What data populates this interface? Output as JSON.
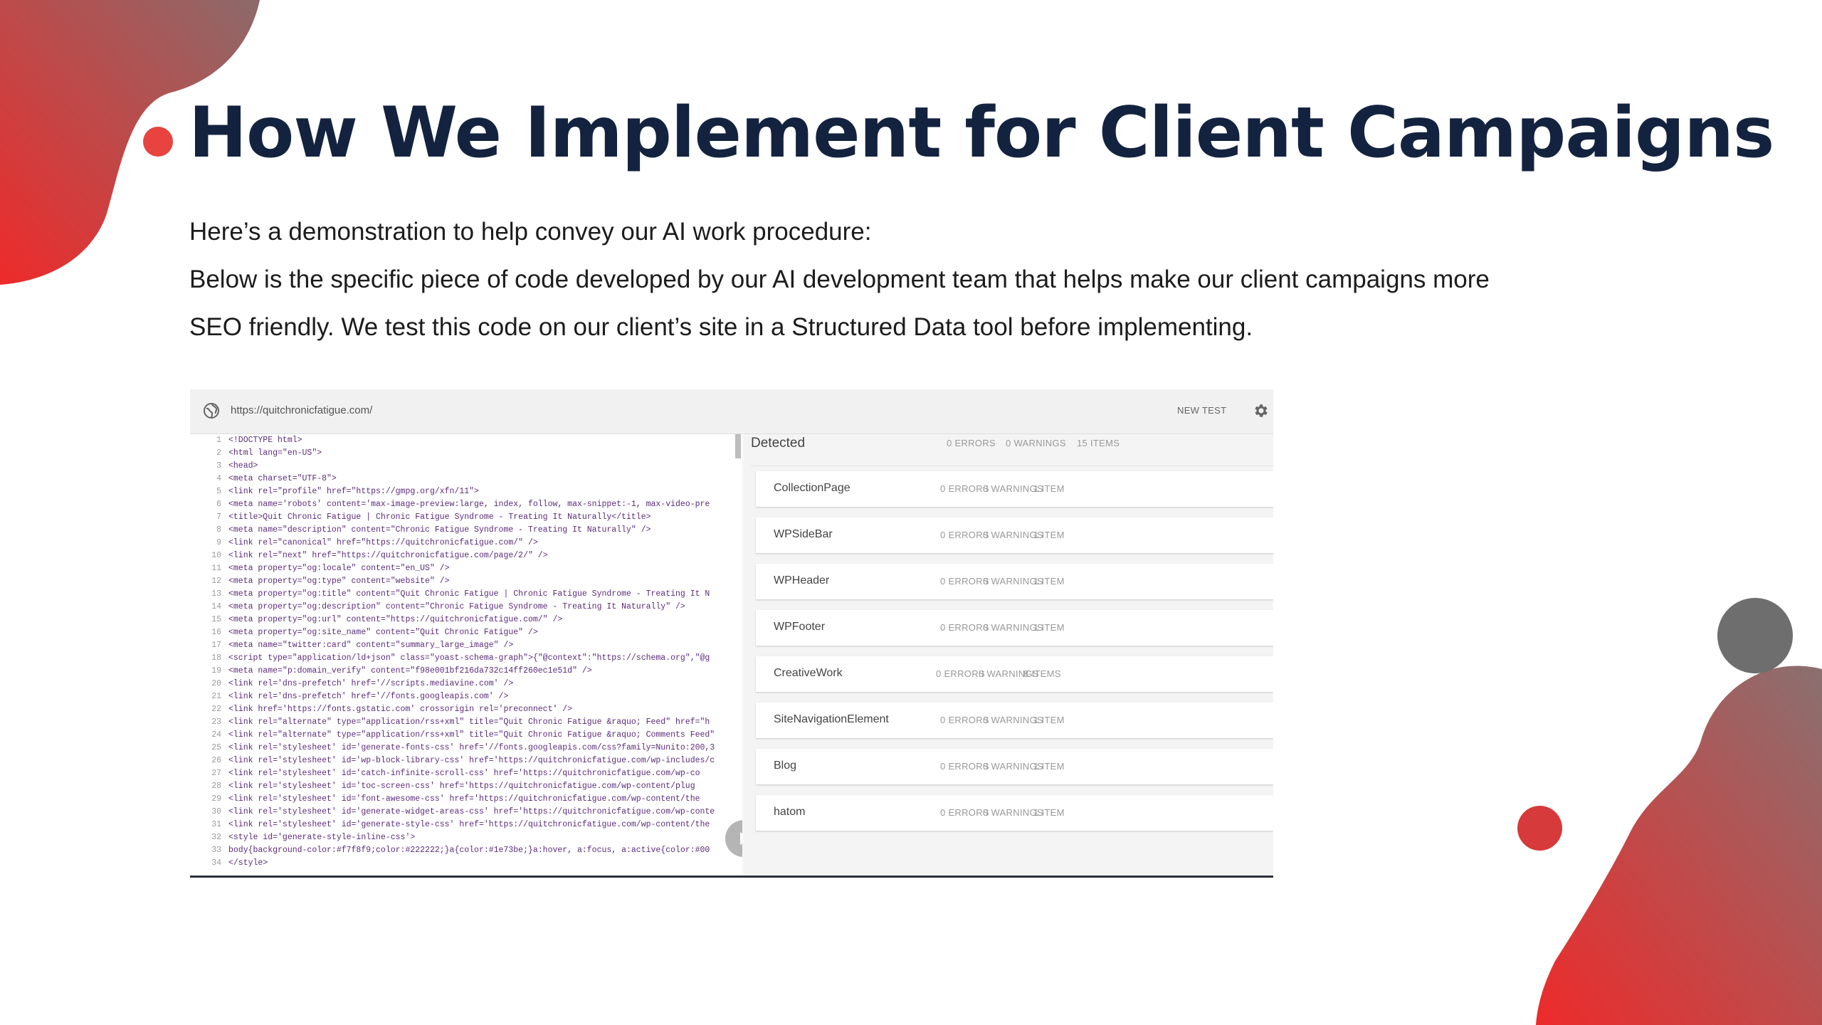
{
  "slide": {
    "title": "How We Implement for Client Campaigns",
    "intro": "Here’s a demonstration to help convey our AI work procedure:",
    "line2": "Below is the specific piece of code developed by our AI development team that helps make our client campaigns more",
    "line3": "SEO friendly. We test this code on our client’s site in a Structured Data tool before implementing.",
    "accent_color": "#e8433f",
    "title_color": "#13233f"
  },
  "tool": {
    "url": "https://quitchronicfatigue.com/",
    "new_test_label": "NEW TEST",
    "icons": {
      "globe": "globe-icon",
      "settings": "gear-icon",
      "play": "play-icon"
    },
    "code_lines": [
      "<!DOCTYPE html>",
      "<html lang=\"en-US\">",
      "<head>",
      "<meta charset=\"UTF-8\">",
      "<link rel=\"profile\" href=\"https://gmpg.org/xfn/11\">",
      "<meta name='robots' content='max-image-preview:large, index, follow, max-snippet:-1, max-video-pre",
      "<title>Quit Chronic Fatigue | Chronic Fatigue Syndrome - Treating It Naturally</title>",
      "<meta name=\"description\" content=\"Chronic Fatigue Syndrome - Treating It Naturally\" />",
      "<link rel=\"canonical\" href=\"https://quitchronicfatigue.com/\" />",
      "<link rel=\"next\" href=\"https://quitchronicfatigue.com/page/2/\" />",
      "<meta property=\"og:locale\" content=\"en_US\" />",
      "<meta property=\"og:type\" content=\"website\" />",
      "<meta property=\"og:title\" content=\"Quit Chronic Fatigue | Chronic Fatigue Syndrome - Treating It N",
      "<meta property=\"og:description\" content=\"Chronic Fatigue Syndrome - Treating It Naturally\" />",
      "<meta property=\"og:url\" content=\"https://quitchronicfatigue.com/\" />",
      "<meta property=\"og:site_name\" content=\"Quit Chronic Fatigue\" />",
      "<meta name=\"twitter:card\" content=\"summary_large_image\" />",
      "<script type=\"application/ld+json\" class=\"yoast-schema-graph\">{\"@context\":\"https://schema.org\",\"@g",
      "<meta name=\"p:domain_verify\" content=\"f98e001bf216da732c14ff260ec1e51d\" />",
      "<link rel='dns-prefetch' href='//scripts.mediavine.com' />",
      "<link rel='dns-prefetch' href='//fonts.googleapis.com' />",
      "<link href='https://fonts.gstatic.com' crossorigin rel='preconnect' />",
      "<link rel=\"alternate\" type=\"application/rss+xml\" title=\"Quit Chronic Fatigue &raquo; Feed\" href=\"h",
      "<link rel=\"alternate\" type=\"application/rss+xml\" title=\"Quit Chronic Fatigue &raquo; Comments Feed\"",
      "<link rel='stylesheet' id='generate-fonts-css' href='//fonts.googleapis.com/css?family=Nunito:200,3",
      "<link rel='stylesheet' id='wp-block-library-css' href='https://quitchronicfatigue.com/wp-includes/c",
      "<link rel='stylesheet' id='catch-infinite-scroll-css' href='https://quitchronicfatigue.com/wp-co",
      "<link rel='stylesheet' id='toc-screen-css' href='https://quitchronicfatigue.com/wp-content/plug",
      "<link rel='stylesheet' id='font-awesome-css' href='https://quitchronicfatigue.com/wp-content/the",
      "<link rel='stylesheet' id='generate-widget-areas-css' href='https://quitchronicfatigue.com/wp-conte",
      "<link rel='stylesheet' id='generate-style-css' href='https://quitchronicfatigue.com/wp-content/the",
      "<style id='generate-style-inline-css'>",
      "body{background-color:#f7f8f9;color:#222222;}a{color:#1e73be;}a:hover, a:focus, a:active{color:#00",
      "</style>"
    ],
    "detected": {
      "label": "Detected",
      "errors": "0 ERRORS",
      "warnings": "0 WARNINGS",
      "items": "15 ITEMS"
    },
    "results": [
      {
        "name": "CollectionPage",
        "errors": "0 ERRORS",
        "warnings": "0 WARNINGS",
        "items": "1 ITEM"
      },
      {
        "name": "WPSideBar",
        "errors": "0 ERRORS",
        "warnings": "0 WARNINGS",
        "items": "1 ITEM"
      },
      {
        "name": "WPHeader",
        "errors": "0 ERRORS",
        "warnings": "0 WARNINGS",
        "items": "1 ITEM"
      },
      {
        "name": "WPFooter",
        "errors": "0 ERRORS",
        "warnings": "0 WARNINGS",
        "items": "1 ITEM"
      },
      {
        "name": "CreativeWork",
        "errors": "0 ERRORS",
        "warnings": "0 WARNINGS",
        "items": "8 ITEMS"
      },
      {
        "name": "SiteNavigationElement",
        "errors": "0 ERRORS",
        "warnings": "0 WARNINGS",
        "items": "1 ITEM"
      },
      {
        "name": "Blog",
        "errors": "0 ERRORS",
        "warnings": "0 WARNINGS",
        "items": "1 ITEM"
      },
      {
        "name": "hatom",
        "errors": "0 ERRORS",
        "warnings": "0 WARNINGS",
        "items": "1 ITEM"
      }
    ]
  }
}
